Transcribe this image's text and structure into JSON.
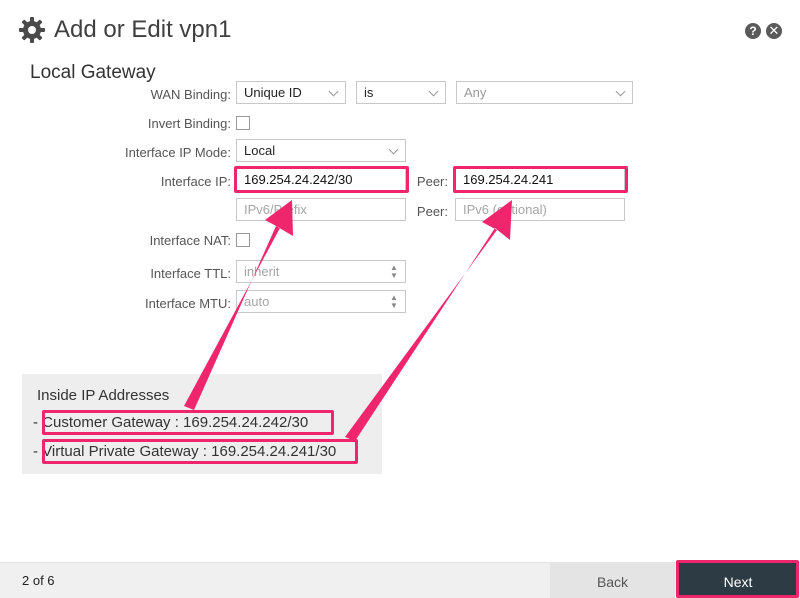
{
  "window": {
    "title": "Add or Edit vpn1",
    "help_icon": "?",
    "close_icon": "✕"
  },
  "section": {
    "title": "Local Gateway"
  },
  "form": {
    "wan_binding": {
      "label": "WAN Binding:",
      "type": "Unique ID",
      "operator": "is",
      "value": "Any"
    },
    "invert_binding": {
      "label": "Invert Binding:",
      "checked": false
    },
    "interface_ip_mode": {
      "label": "Interface IP Mode:",
      "value": "Local"
    },
    "interface_ip": {
      "label": "Interface IP:",
      "value": "169.254.24.242/30",
      "peer_label": "Peer:",
      "peer_value": "169.254.24.241"
    },
    "ipv6": {
      "placeholder": "IPv6/Prefix",
      "peer_label": "Peer:",
      "peer_placeholder": "IPv6 (optional)"
    },
    "interface_nat": {
      "label": "Interface NAT:",
      "checked": false
    },
    "interface_ttl": {
      "label": "Interface TTL:",
      "placeholder": "inherit"
    },
    "interface_mtu": {
      "label": "Interface MTU:",
      "placeholder": "auto"
    }
  },
  "info": {
    "title": "Inside IP Addresses",
    "dash": "-",
    "customer_gateway": "Customer Gateway : 169.254.24.242/30",
    "virtual_private_gateway": "Virtual Private Gateway : 169.254.24.241/30"
  },
  "footer": {
    "step": "2 of 6",
    "back_label": "Back",
    "next_label": "Next"
  },
  "colors": {
    "highlight": "#f0266c",
    "next_button": "#2d3b45"
  }
}
